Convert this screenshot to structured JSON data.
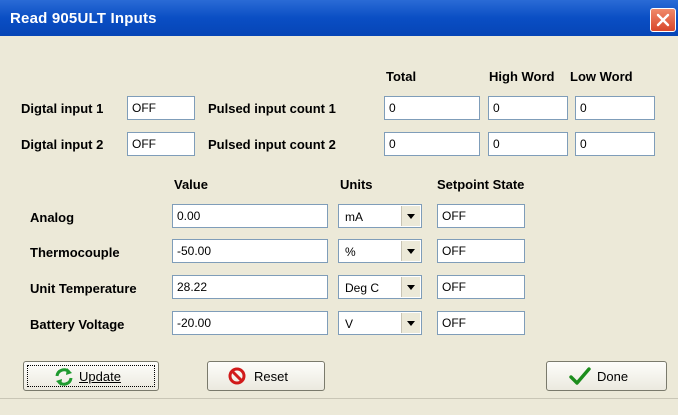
{
  "window": {
    "title": "Read 905ULT Inputs"
  },
  "digital": {
    "input1_label": "Digtal input 1",
    "input1_value": "OFF",
    "input2_label": "Digtal input 2",
    "input2_value": "OFF"
  },
  "pulsed": {
    "total_header": "Total",
    "high_header": "High Word",
    "low_header": "Low Word",
    "rows": [
      {
        "label": "Pulsed input count 1",
        "total": "0",
        "high": "0",
        "low": "0"
      },
      {
        "label": "Pulsed input count 2",
        "total": "0",
        "high": "0",
        "low": "0"
      }
    ]
  },
  "analog": {
    "value_header": "Value",
    "units_header": "Units",
    "setpoint_header": "Setpoint State",
    "rows": [
      {
        "label": "Analog",
        "value": "0.00",
        "units": "mA",
        "setpoint": "OFF"
      },
      {
        "label": "Thermocouple",
        "value": "-50.00",
        "units": "%",
        "setpoint": "OFF"
      },
      {
        "label": "Unit Temperature",
        "value": "28.22",
        "units": "Deg C",
        "setpoint": "OFF"
      },
      {
        "label": "Battery Voltage",
        "value": "-20.00",
        "units": "V",
        "setpoint": "OFF"
      }
    ]
  },
  "buttons": {
    "update_label": "Update",
    "update_icon": "refresh-icon",
    "reset_label": "Reset",
    "reset_icon": "no-entry-icon",
    "done_label": "Done",
    "done_icon": "checkmark-icon"
  },
  "colors": {
    "titlebar": "#0a4ec4",
    "dialog": "#ece9d8",
    "close": "#d8472c"
  }
}
